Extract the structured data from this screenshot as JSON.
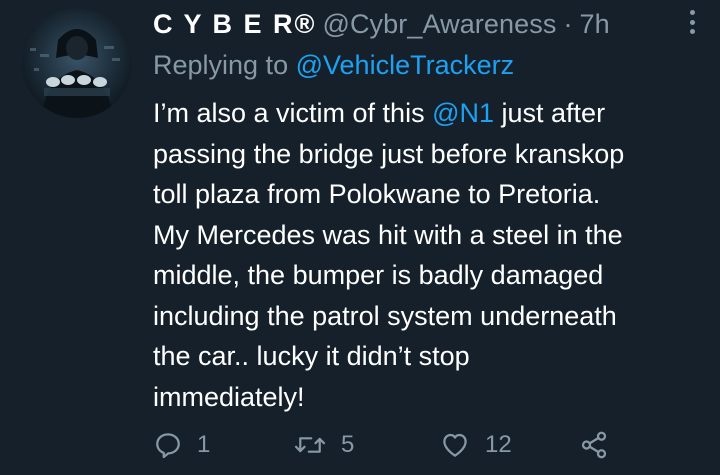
{
  "tweet": {
    "display_name": "C Y B E R®",
    "handle": "@Cybr_Awareness",
    "separator": "·",
    "time": "7h",
    "replying_prefix": "Replying to",
    "replying_to": "@VehicleTrackerz",
    "lines": [
      {
        "before": "I’m also a victim of this ",
        "mention": "@N1",
        "after": " just after"
      },
      {
        "text": "passing the bridge just before kranskop"
      },
      {
        "text": "toll plaza from Polokwane to Pretoria."
      },
      {
        "text": "My Mercedes was hit with a steel in the"
      },
      {
        "text": "middle, the bumper is badly damaged"
      },
      {
        "text": "including the patrol system underneath"
      },
      {
        "text": "the car.. lucky it didn’t stop"
      },
      {
        "text": "immediately!"
      }
    ],
    "reply_count": "1",
    "retweet_count": "5",
    "like_count": "12"
  },
  "icons": {
    "more": "more-options-icon",
    "reply": "reply-icon",
    "retweet": "retweet-icon",
    "like": "heart-icon",
    "share": "share-icon"
  },
  "colors": {
    "background": "#15202b",
    "muted": "#8899a6",
    "link": "#1da1f2",
    "text": "#ffffff"
  }
}
